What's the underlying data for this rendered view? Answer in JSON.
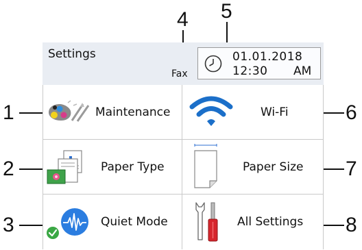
{
  "callouts": [
    "1",
    "2",
    "3",
    "4",
    "5",
    "6",
    "7",
    "8"
  ],
  "header": {
    "title": "Settings",
    "fax_label": "Fax",
    "date": "01.01.2018",
    "time": "12:30",
    "ampm": "AM"
  },
  "tiles": [
    {
      "label": "Maintenance",
      "icon": "ink-cartridges-icon"
    },
    {
      "label": "Wi-Fi",
      "icon": "wifi-icon"
    },
    {
      "label": "Paper Type",
      "icon": "paper-type-icon"
    },
    {
      "label": "Paper Size",
      "icon": "paper-size-icon"
    },
    {
      "label": "Quiet Mode",
      "icon": "quiet-mode-icon"
    },
    {
      "label": "All Settings",
      "icon": "tools-icon"
    }
  ],
  "colors": {
    "header_bg": "#e9edf3",
    "wifi_blue": "#1b6fc9",
    "quiet_blue": "#2b7de0",
    "check_green": "#3aa744",
    "tool_red": "#d6262d"
  }
}
